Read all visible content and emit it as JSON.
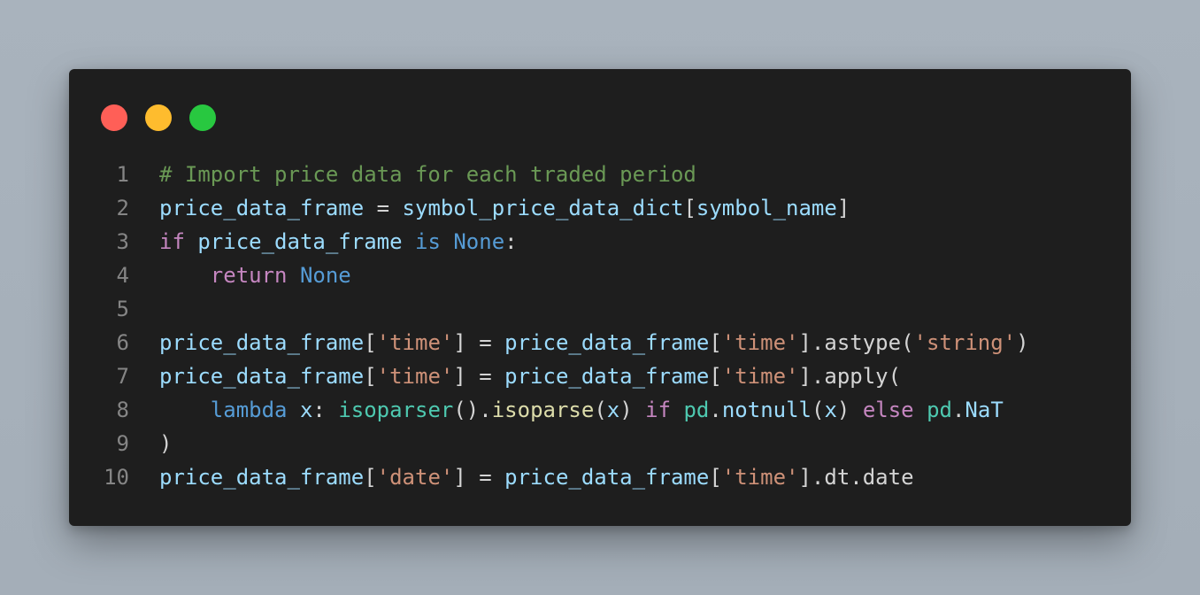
{
  "window": {
    "buttons": [
      {
        "name": "close",
        "color": "#ff5f57"
      },
      {
        "name": "minimize",
        "color": "#febc2e"
      },
      {
        "name": "maximize",
        "color": "#28c840"
      }
    ]
  },
  "colors": {
    "comment": "#6a9955",
    "variable": "#9cdcfe",
    "keyword_control": "#c586c0",
    "keyword": "#569cd6",
    "string": "#ce9178",
    "function": "#dcdcaa",
    "class": "#4ec9b0",
    "plain": "#d4d4d4"
  },
  "code": {
    "lines": [
      {
        "number": "1",
        "tokens": [
          {
            "t": "# Import price data for each traded period",
            "k": "comment"
          }
        ]
      },
      {
        "number": "2",
        "tokens": [
          {
            "t": "price_data_frame",
            "k": "variable"
          },
          {
            "t": " = ",
            "k": "plain"
          },
          {
            "t": "symbol_price_data_dict",
            "k": "variable"
          },
          {
            "t": "[",
            "k": "plain"
          },
          {
            "t": "symbol_name",
            "k": "variable"
          },
          {
            "t": "]",
            "k": "plain"
          }
        ]
      },
      {
        "number": "3",
        "tokens": [
          {
            "t": "if",
            "k": "keyword_control"
          },
          {
            "t": " ",
            "k": "plain"
          },
          {
            "t": "price_data_frame",
            "k": "variable"
          },
          {
            "t": " ",
            "k": "plain"
          },
          {
            "t": "is",
            "k": "keyword"
          },
          {
            "t": " ",
            "k": "plain"
          },
          {
            "t": "None",
            "k": "keyword"
          },
          {
            "t": ":",
            "k": "plain"
          }
        ]
      },
      {
        "number": "4",
        "tokens": [
          {
            "t": "    ",
            "k": "plain"
          },
          {
            "t": "return",
            "k": "keyword_control"
          },
          {
            "t": " ",
            "k": "plain"
          },
          {
            "t": "None",
            "k": "keyword"
          }
        ]
      },
      {
        "number": "5",
        "tokens": []
      },
      {
        "number": "6",
        "tokens": [
          {
            "t": "price_data_frame",
            "k": "variable"
          },
          {
            "t": "[",
            "k": "plain"
          },
          {
            "t": "'time'",
            "k": "string"
          },
          {
            "t": "] = ",
            "k": "plain"
          },
          {
            "t": "price_data_frame",
            "k": "variable"
          },
          {
            "t": "[",
            "k": "plain"
          },
          {
            "t": "'time'",
            "k": "string"
          },
          {
            "t": "].astype(",
            "k": "plain"
          },
          {
            "t": "'string'",
            "k": "string"
          },
          {
            "t": ")",
            "k": "plain"
          }
        ]
      },
      {
        "number": "7",
        "tokens": [
          {
            "t": "price_data_frame",
            "k": "variable"
          },
          {
            "t": "[",
            "k": "plain"
          },
          {
            "t": "'time'",
            "k": "string"
          },
          {
            "t": "] = ",
            "k": "plain"
          },
          {
            "t": "price_data_frame",
            "k": "variable"
          },
          {
            "t": "[",
            "k": "plain"
          },
          {
            "t": "'time'",
            "k": "string"
          },
          {
            "t": "].apply(",
            "k": "plain"
          }
        ]
      },
      {
        "number": "8",
        "tokens": [
          {
            "t": "    ",
            "k": "plain"
          },
          {
            "t": "lambda",
            "k": "keyword"
          },
          {
            "t": " ",
            "k": "plain"
          },
          {
            "t": "x",
            "k": "variable"
          },
          {
            "t": ": ",
            "k": "plain"
          },
          {
            "t": "isoparser",
            "k": "class"
          },
          {
            "t": "().",
            "k": "plain"
          },
          {
            "t": "isoparse",
            "k": "function"
          },
          {
            "t": "(",
            "k": "plain"
          },
          {
            "t": "x",
            "k": "variable"
          },
          {
            "t": ") ",
            "k": "plain"
          },
          {
            "t": "if",
            "k": "keyword_control"
          },
          {
            "t": " ",
            "k": "plain"
          },
          {
            "t": "pd",
            "k": "class"
          },
          {
            "t": ".",
            "k": "plain"
          },
          {
            "t": "notnull",
            "k": "variable"
          },
          {
            "t": "(",
            "k": "plain"
          },
          {
            "t": "x",
            "k": "variable"
          },
          {
            "t": ") ",
            "k": "plain"
          },
          {
            "t": "else",
            "k": "keyword_control"
          },
          {
            "t": " ",
            "k": "plain"
          },
          {
            "t": "pd",
            "k": "class"
          },
          {
            "t": ".",
            "k": "plain"
          },
          {
            "t": "NaT",
            "k": "variable"
          }
        ]
      },
      {
        "number": "9",
        "tokens": [
          {
            "t": ")",
            "k": "plain"
          }
        ]
      },
      {
        "number": "10",
        "tokens": [
          {
            "t": "price_data_frame",
            "k": "variable"
          },
          {
            "t": "[",
            "k": "plain"
          },
          {
            "t": "'date'",
            "k": "string"
          },
          {
            "t": "] = ",
            "k": "plain"
          },
          {
            "t": "price_data_frame",
            "k": "variable"
          },
          {
            "t": "[",
            "k": "plain"
          },
          {
            "t": "'time'",
            "k": "string"
          },
          {
            "t": "].dt.date",
            "k": "plain"
          }
        ]
      }
    ]
  }
}
